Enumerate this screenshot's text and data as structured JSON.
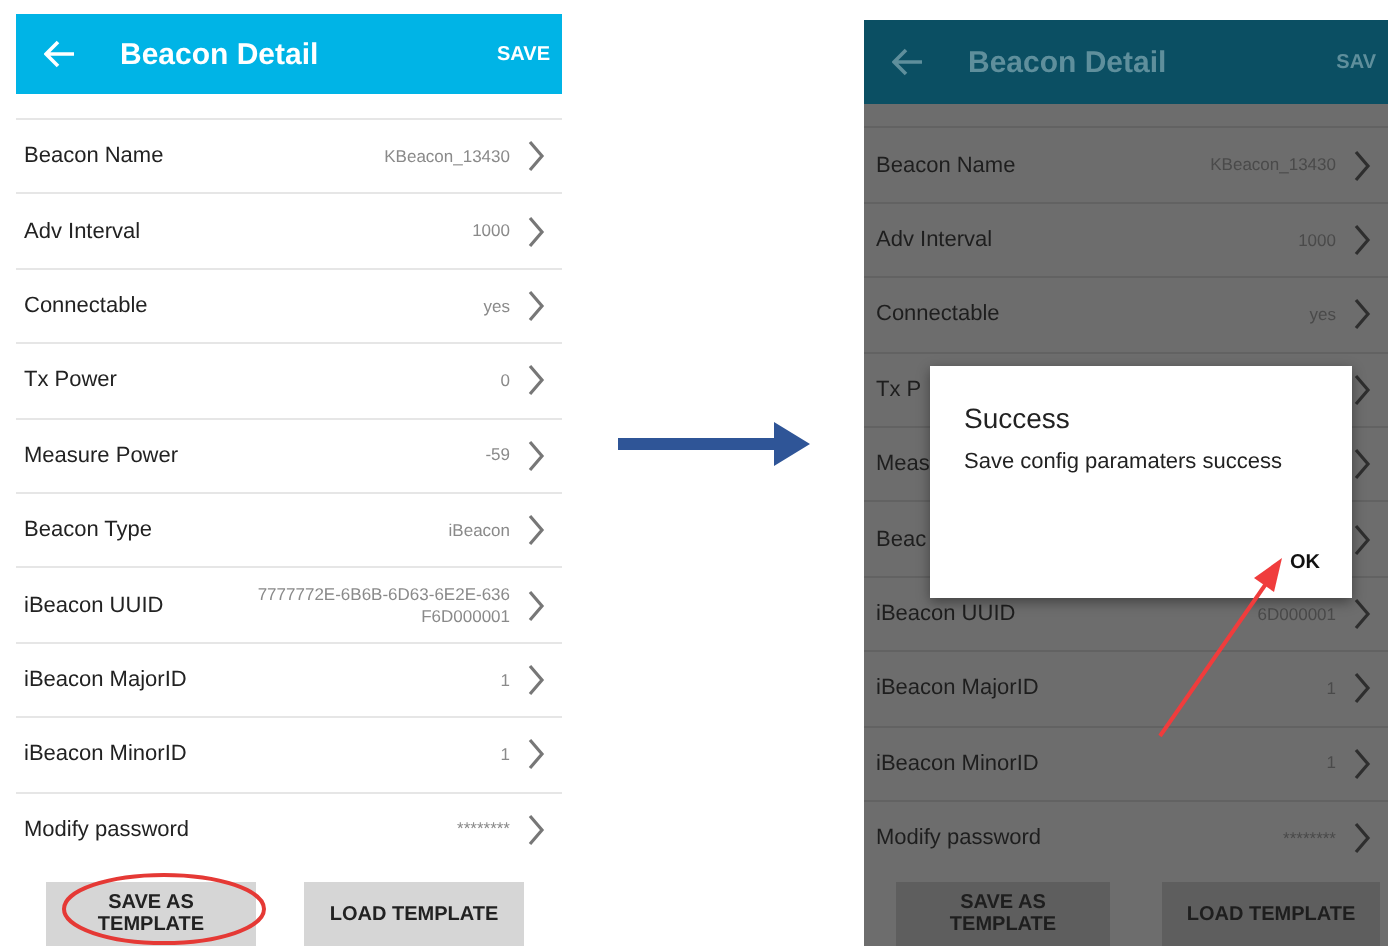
{
  "screens": [
    {
      "dimmed": false,
      "header": {
        "title": "Beacon Detail",
        "action": "SAVE"
      },
      "rows": [
        {
          "label": "Beacon Name",
          "value": "KBeacon_13430"
        },
        {
          "label": "Adv Interval",
          "value": "1000"
        },
        {
          "label": "Connectable",
          "value": "yes"
        },
        {
          "label": "Tx Power",
          "value": "0"
        },
        {
          "label": "Measure Power",
          "value": "-59"
        },
        {
          "label": "Beacon Type",
          "value": "iBeacon"
        },
        {
          "label": "iBeacon UUID",
          "value": "7777772E-6B6B-6D63-6E2E-636F6D000001"
        },
        {
          "label": "iBeacon MajorID",
          "value": "1"
        },
        {
          "label": "iBeacon MinorID",
          "value": "1"
        },
        {
          "label": "Modify password",
          "value": "********"
        }
      ],
      "buttons": [
        "SAVE AS TEMPLATE",
        "LOAD TEMPLATE"
      ]
    },
    {
      "dimmed": true,
      "header": {
        "title": "Beacon Detail",
        "action": "SAV"
      },
      "rows": [
        {
          "label": "Beacon Name",
          "value": "KBeacon_13430"
        },
        {
          "label": "Adv Interval",
          "value": "1000"
        },
        {
          "label": "Connectable",
          "value": "yes"
        },
        {
          "label": "Tx P"
        },
        {
          "label": "Meas"
        },
        {
          "label": "Beac"
        },
        {
          "label": "iBeacon UUID",
          "value": "6D000001"
        },
        {
          "label": "iBeacon MajorID",
          "value": "1"
        },
        {
          "label": "iBeacon MinorID",
          "value": "1"
        },
        {
          "label": "Modify password",
          "value": "********"
        }
      ],
      "buttons": [
        "SAVE AS TEMPLATE",
        "LOAD TEMPLATE"
      ],
      "dialog": {
        "title": "Success",
        "message": "Save config paramaters success",
        "button": "OK"
      }
    }
  ]
}
